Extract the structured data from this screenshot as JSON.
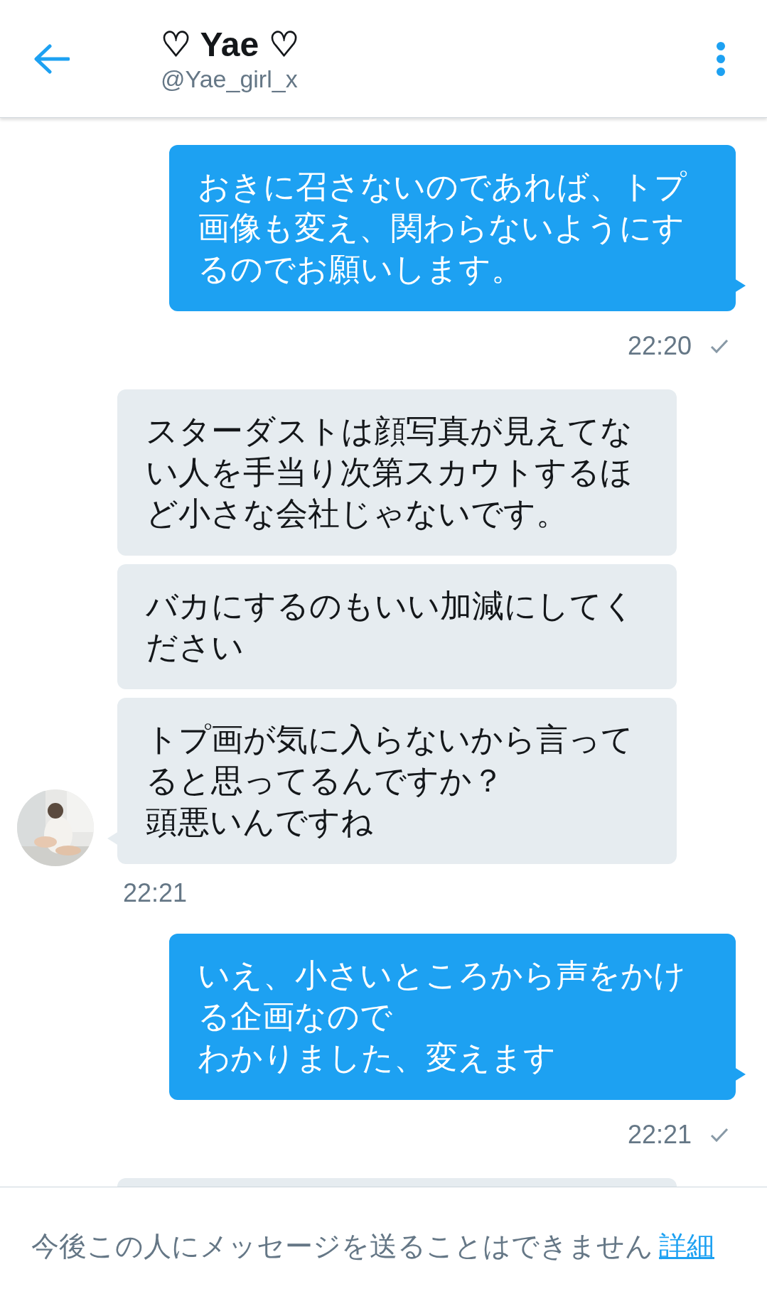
{
  "header": {
    "title": "♡ Yae ♡",
    "handle": "@Yae_girl_x"
  },
  "groups": [
    {
      "kind": "sent",
      "bubbles": [
        {
          "lines": [
            "おきに召さないのであれば、トプ画像も変え、関わらないようにするのでお願いします。"
          ]
        }
      ],
      "time": "22:20"
    },
    {
      "kind": "received",
      "bubbles": [
        {
          "lines": [
            "スターダストは顔写真が見えてない人を手当り次第スカウトするほど小さな会社じゃないです。"
          ]
        },
        {
          "lines": [
            "バカにするのもいい加減にしてください"
          ]
        },
        {
          "lines": [
            "トプ画が気に入らないから言ってると思ってるんですか？",
            "頭悪いんですね"
          ]
        }
      ],
      "time": "22:21"
    },
    {
      "kind": "sent",
      "bubbles": [
        {
          "lines": [
            "いえ、小さいところから声をかける企画なので",
            "わかりました、変えます"
          ]
        }
      ],
      "time": "22:21"
    },
    {
      "kind": "received",
      "bubbles": [
        {
          "kind": "cut"
        }
      ]
    }
  ],
  "footer": {
    "notice": "今後この人にメッセージを送ることはできません",
    "link": "詳細"
  }
}
